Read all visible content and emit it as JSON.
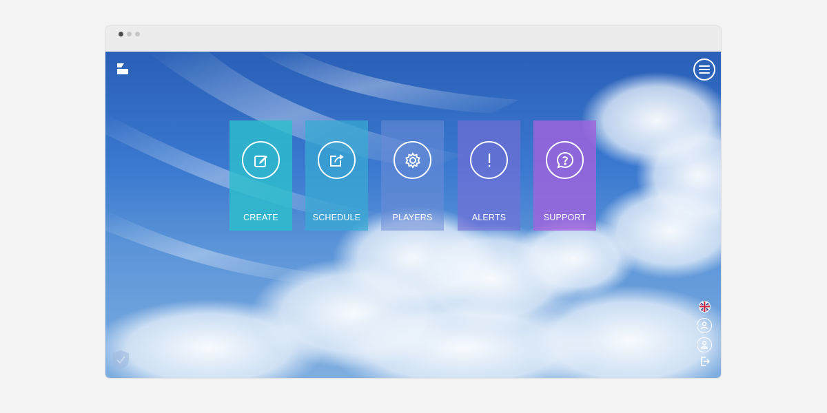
{
  "window": {
    "dots": [
      "close",
      "minimize",
      "maximize"
    ]
  },
  "header": {
    "logo_icon": "brand-logo-icon",
    "menu_icon": "hamburger-menu-icon"
  },
  "tiles": [
    {
      "label": "CREATE",
      "icon": "edit-icon",
      "color": "#2dbecd"
    },
    {
      "label": "SCHEDULE",
      "icon": "share-icon",
      "color": "#37aad2"
    },
    {
      "label": "PLAYERS",
      "icon": "gear-icon",
      "color": "#6e8cd7"
    },
    {
      "label": "ALERTS",
      "icon": "exclamation-icon",
      "color": "#786ed7"
    },
    {
      "label": "SUPPORT",
      "icon": "question-bubble-icon",
      "color": "#a064dc"
    }
  ],
  "side_controls": {
    "language_icon": "uk-flag-icon",
    "account_icons": [
      "user-settings-icon",
      "user-icon"
    ],
    "logout_icon": "logout-icon"
  },
  "footer": {
    "security_icon": "shield-check-icon"
  }
}
